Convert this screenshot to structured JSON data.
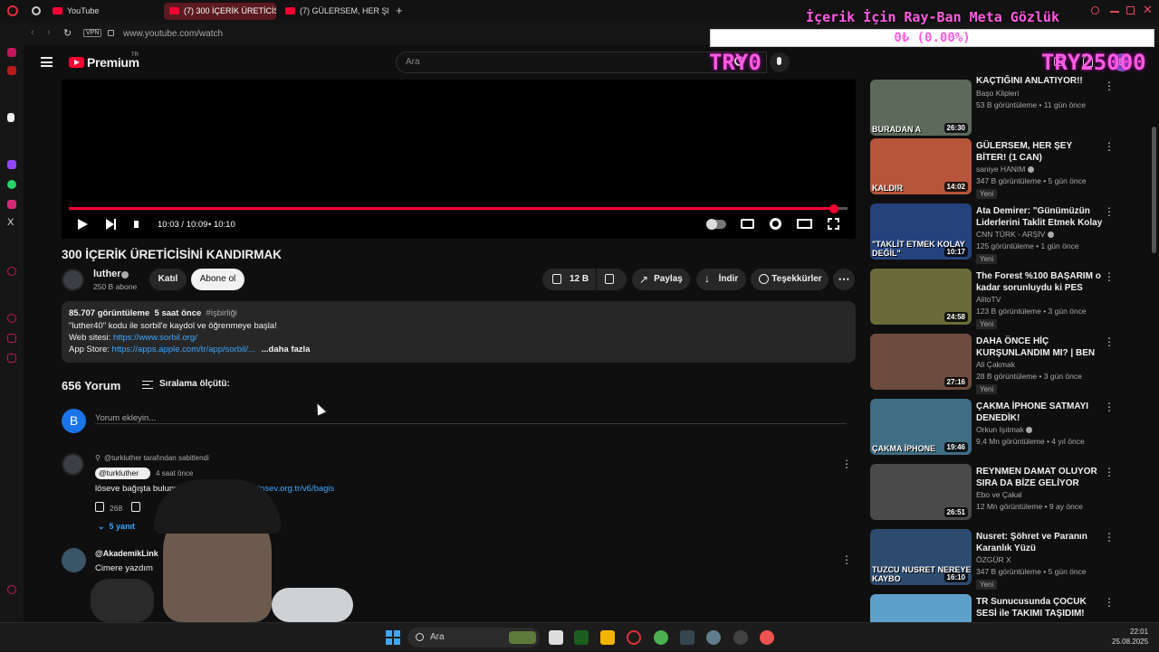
{
  "browser": {
    "tabs": [
      {
        "label": "YouTube"
      },
      {
        "label": "(7) 300 İÇERİK ÜRETİCİSİ"
      },
      {
        "label": "(7) GÜLERSEM, HER ŞEY"
      }
    ],
    "new_tab": "+",
    "vpn": "VPN",
    "url": "www.youtube.com/watch"
  },
  "header": {
    "logo": "Premium",
    "logo_sup": "TR",
    "search_placeholder": "Ara",
    "avatar_letter": "B",
    "notification_count": "1"
  },
  "overlay": {
    "title": "İçerik İçin Ray-Ban Meta Gözlük",
    "progress": "0₺ (0.00%)",
    "progress_fraction": 0.0,
    "left_amount": "TRY0",
    "right_amount": "TRY25000"
  },
  "player": {
    "time": "10:03 / 10:09",
    "chapter": "• 10:10",
    "progress_fraction": 0.983
  },
  "video": {
    "title": "300 İÇERİK ÜRETİCİSİNİ KANDIRMAK",
    "channel": "luther",
    "subscribers": "250 B abone",
    "join": "Katıl",
    "subscribe": "Abone ol",
    "likes": "12 B",
    "share": "Paylaş",
    "download": "İndir",
    "thanks": "Teşekkürler"
  },
  "description": {
    "views": "85.707 görüntüleme",
    "age": "5 saat önce",
    "tag": "#işbirliği",
    "line1": "\"luther40\" kodu ile sorbil'e kaydol ve öğrenmeye başla!",
    "web_label": "Web sitesi:",
    "web_link": "https://www.sorbil.org/",
    "app_label": "App Store:",
    "app_link": "https://apps.apple.com/tr/app/sorbil/...",
    "more": "...daha fazla"
  },
  "comments": {
    "count": "656 Yorum",
    "sort": "Sıralama ölçütü:",
    "placeholder": "Yorum ekleyin...",
    "avatar_letter": "B",
    "pinned_by": "@turkluther tarafından sabitlendi",
    "c1_author": "@turkluther",
    "c1_age": "4 saat önce",
    "c1_text": "löseve bağışta bulunm",
    "c1_link": "losev.org.tr/v6/bagis",
    "c1_likes": "268",
    "c1_replies": "5 yanıt",
    "c2_author": "@AkademikLink",
    "c2_text": "Cimere yazdım"
  },
  "sidebar": {
    "videos": [
      {
        "title": "KAÇTIĞINI ANLATIYOR!!",
        "channel": "Başo Klipleri",
        "meta": "53 B görüntüleme • 11 gün önce",
        "duration": "26:30",
        "thumb_text": "BURADAN A",
        "verified": false,
        "new": false
      },
      {
        "title": "GÜLERSEM, HER ŞEY BİTER! (1 CAN)",
        "channel": "saniye HANIM",
        "meta": "347 B görüntüleme • 5 gün önce",
        "duration": "14:02",
        "thumb_text": "KALDIR",
        "verified": true,
        "new": true
      },
      {
        "title": "Ata Demirer: \"Günümüzün Liderlerini Taklit Etmek Kolay ...",
        "channel": "CNN TÜRK - ARŞİV",
        "meta": "125 görüntüleme • 1 gün önce",
        "duration": "10:17",
        "thumb_text": "\"TAKLİT ETMEK KOLAY DEĞİL\"",
        "verified": true,
        "new": true
      },
      {
        "title": "The Forest %100 BAŞARIM o kadar sorunluydu ki PES ETME...",
        "channel": "AlitoTV",
        "meta": "123 B görüntüleme • 3 gün önce",
        "duration": "24:58",
        "thumb_text": "",
        "verified": false,
        "new": true
      },
      {
        "title": "DAHA ÖNCE HİÇ KURŞUNLANDIM MI? | BEN ...",
        "channel": "Ali Çakmak",
        "meta": "28 B görüntüleme • 3 gün önce",
        "duration": "27:16",
        "thumb_text": "",
        "verified": false,
        "new": true
      },
      {
        "title": "ÇAKMA İPHONE SATMAYI DENEDİK!",
        "channel": "Orkun Işıtmak",
        "meta": "9,4 Mn görüntüleme • 4 yıl önce",
        "duration": "19:46",
        "thumb_text": "ÇAKMA İPHONE",
        "verified": true,
        "new": false
      },
      {
        "title": "REYNMEN DAMAT OLUYOR SIRA DA BİZE GELİYOR",
        "channel": "Ebo ve Çakal",
        "meta": "12 Mn görüntüleme • 9 ay önce",
        "duration": "26:51",
        "thumb_text": "",
        "verified": false,
        "new": false
      },
      {
        "title": "Nusret: Şöhret ve Paranın Karanlık Yüzü",
        "channel": "ÖZGÜR X",
        "meta": "347 B görüntüleme • 5 gün önce",
        "duration": "16:10",
        "thumb_text": "TUZCU NUSRET NEREYE KAYBO",
        "verified": false,
        "new": true
      },
      {
        "title": "TR Sunucusunda ÇOCUK SESİ ile TAKIMI TAŞIDIM! (nasıl tep...",
        "channel": "overdosevi",
        "meta": "161 B görüntüleme • 2 gün önce",
        "duration": "20:37",
        "thumb_text": "",
        "verified": true,
        "new": false
      }
    ]
  },
  "taskbar": {
    "search": "Ara",
    "time": "22:01",
    "date": "25.08.2025"
  },
  "colors": {
    "accent_red": "#ff0033",
    "overlay_pink": "#ff5ce1",
    "bg": "#0f0f0f",
    "link": "#3ea6ff"
  }
}
